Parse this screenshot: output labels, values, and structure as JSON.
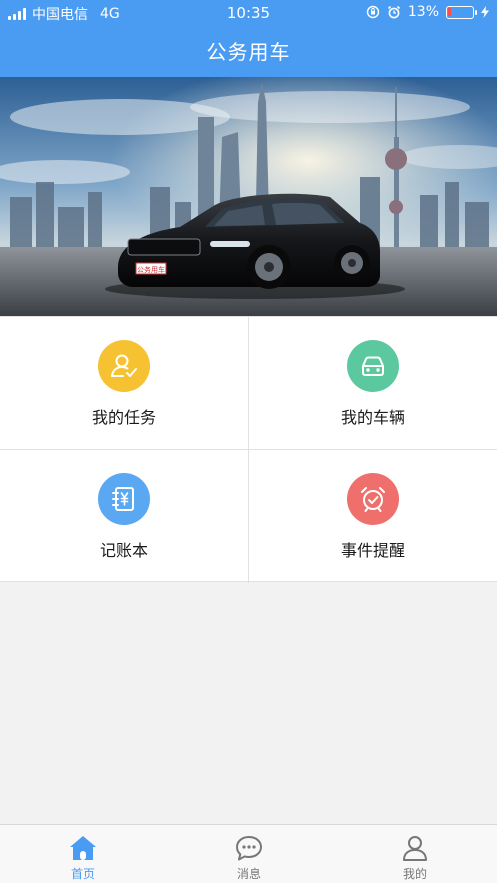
{
  "status_bar": {
    "carrier": "中国电信",
    "network": "4G",
    "time": "10:35",
    "battery_text": "13%",
    "battery_level": 0.13
  },
  "header": {
    "title": "公务用车"
  },
  "banner": {
    "plate_text": "公务用车"
  },
  "grid": {
    "items": [
      {
        "label": "我的任务",
        "icon": "person-check-icon",
        "color": "#f6c232"
      },
      {
        "label": "我的车辆",
        "icon": "car-icon",
        "color": "#5cc8a0"
      },
      {
        "label": "记账本",
        "icon": "yen-book-icon",
        "color": "#5aa8f2"
      },
      {
        "label": "事件提醒",
        "icon": "alarm-clock-icon",
        "color": "#ef6f6c"
      }
    ]
  },
  "tabbar": {
    "tabs": [
      {
        "label": "首页",
        "icon": "home-icon",
        "active": true
      },
      {
        "label": "消息",
        "icon": "chat-bubble-icon",
        "active": false
      },
      {
        "label": "我的",
        "icon": "user-icon",
        "active": false
      }
    ]
  },
  "colors": {
    "primary": "#4a9bf2",
    "inactive": "#777777"
  }
}
